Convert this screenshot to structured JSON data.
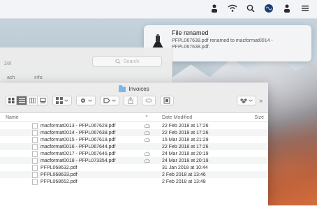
{
  "menubar": {
    "icons": [
      "user-icon",
      "wifi-icon",
      "search-icon",
      "siri-icon",
      "user-icon",
      "list-icon"
    ]
  },
  "notification": {
    "title": "File renamed",
    "body_line1": "PFPL067638.pdf renamed to macformat0014 -",
    "body_line2": "PFPL067638.pdf."
  },
  "bg_finder": {
    "left_text": "zel",
    "search_placeholder": "Search",
    "tab1": "ach",
    "tab2": "info"
  },
  "finder": {
    "title": "Invoices",
    "columns": {
      "name": "Name",
      "sort": "^",
      "date": "Date Modified",
      "size": "Size"
    },
    "files": [
      {
        "name": "macformat0013 - PFPL067629.pdf",
        "cloud": true,
        "date": "22 Feb 2018 at 17:26",
        "size": ""
      },
      {
        "name": "macformat0014 - PFPL067638.pdf",
        "cloud": true,
        "date": "22 Feb 2018 at 17:26",
        "size": ""
      },
      {
        "name": "macformat0015 - PFPL067618.pdf",
        "cloud": true,
        "date": "15 Mar 2018 at 21:29",
        "size": ""
      },
      {
        "name": "macformat0016 - PFPL067644.pdf",
        "cloud": false,
        "date": "22 Feb 2018 at 17:26",
        "size": ""
      },
      {
        "name": "macformat0017 - PFPL067646.pdf",
        "cloud": true,
        "date": "24 Mar 2018 at 20:19",
        "size": ""
      },
      {
        "name": "macformat0018 - PFPL073354.pdf",
        "cloud": true,
        "date": "24 Mar 2018 at 20:19",
        "size": ""
      },
      {
        "name": "PFPL068632.pdf",
        "cloud": false,
        "date": "31 Jan 2018 at 10:44",
        "size": ""
      },
      {
        "name": "PFPL068633.pdf",
        "cloud": false,
        "date": "2 Feb 2018 at 13:46",
        "size": ""
      },
      {
        "name": "PFPL068652.pdf",
        "cloud": false,
        "date": "2 Feb 2018 at 13:48",
        "size": ""
      }
    ]
  }
}
